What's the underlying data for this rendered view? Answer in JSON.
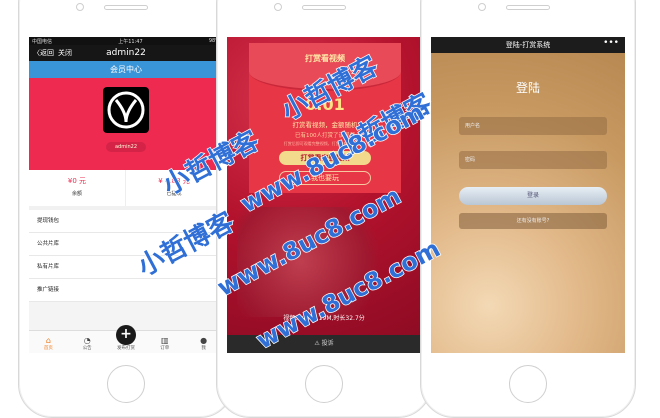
{
  "phone1": {
    "status": {
      "carrier": "中国电信",
      "time": "上午11:47",
      "battery": "98%"
    },
    "nav": {
      "back": "〈返回",
      "close": "关闭",
      "title": "admin22"
    },
    "header": "会员中心",
    "username": "admin22",
    "balance": [
      {
        "value": "¥0 元",
        "label": "余额"
      },
      {
        "value": "¥ 4.88 元",
        "label": "已提现"
      }
    ],
    "menu": [
      "提现钱包",
      "公共片库",
      "私有片库",
      "推广链接"
    ],
    "tabs": [
      {
        "icon": "home-icon",
        "glyph": "⌂",
        "label": "首页"
      },
      {
        "icon": "bell-icon",
        "glyph": "◔",
        "label": "公告"
      },
      {
        "icon": "plus-icon",
        "glyph": "+",
        "label": "发布打赏"
      },
      {
        "icon": "chart-icon",
        "glyph": "▥",
        "label": "订单"
      },
      {
        "icon": "user-icon",
        "glyph": "●",
        "label": "我"
      }
    ]
  },
  "phone2": {
    "title": "打赏看视频",
    "amount": "0.01",
    "line1": "打赏看视频，金额随机",
    "line2": "已有100人打赏了该视频",
    "line3": "打赏后即可观看完整视频，打赏金额不超过3元",
    "btn_watch": "打赏看完整视频",
    "btn_promo": "我也要玩",
    "video_info": "视频大小 18.19M,时长32.7分",
    "report": "⚠ 投诉"
  },
  "phone3": {
    "nav_title": "登陆-打赏系统",
    "nav_more": "•••",
    "heading": "登陆",
    "username_placeholder": "用户名",
    "password_placeholder": "密码",
    "login_button": "登录",
    "register_link": "还有没有账号?"
  },
  "watermark": {
    "text1": "小哲博客",
    "text2": "www.8uc8.com"
  },
  "colors": {
    "red": "#ee2a51",
    "blue": "#3a94d8",
    "watermark": "#2f6fd6"
  }
}
